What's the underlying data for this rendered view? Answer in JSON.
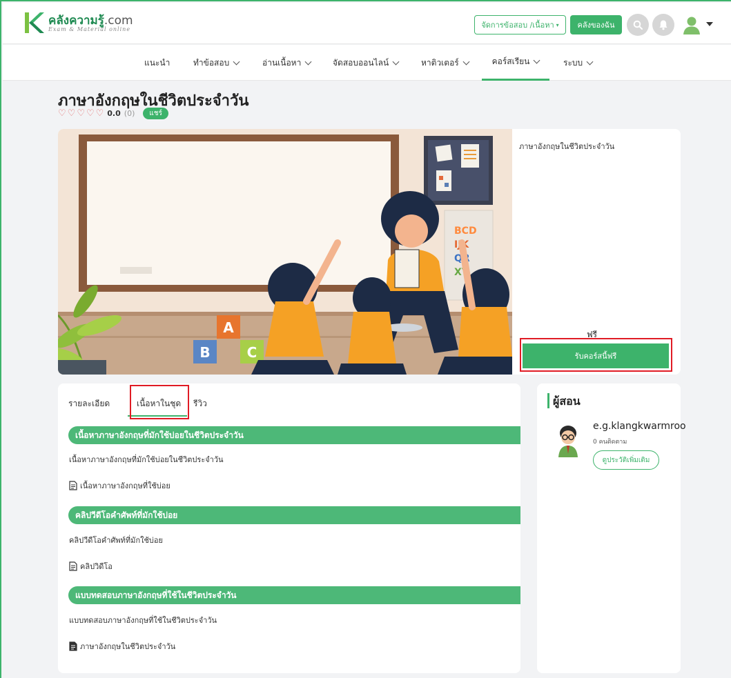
{
  "header": {
    "logo_text": "คลังความรู้",
    "logo_domain": ".com",
    "logo_tagline": "Exam & Material online",
    "manage_button": "จัดการข้อสอบ /เนื้อหา",
    "my_button": "คลังของฉัน"
  },
  "nav": {
    "items": [
      {
        "label": "แนะนำ"
      },
      {
        "label": "ทำข้อสอบ"
      },
      {
        "label": "อ่านเนื้อหา"
      },
      {
        "label": "จัดสอบออนไลน์"
      },
      {
        "label": "หาติวเตอร์"
      },
      {
        "label": "คอร์สเรียน"
      },
      {
        "label": "ระบบ"
      }
    ]
  },
  "course": {
    "title": "ภาษาอังกฤษในชีวิตประจำวัน",
    "rating_value": "0.0",
    "rating_count": "(0)",
    "rating_stars": 0,
    "share_label": "แชร์",
    "side_title": "ภาษาอังกฤษในชีวิตประจำวัน",
    "price_label": "ฟรี",
    "enroll_button": "รับคอร์สนี้ฟรี"
  },
  "hero_image": {
    "blocks": [
      "A",
      "B",
      "C"
    ],
    "board_letters": "BCD\nIJK\nQR\nXY"
  },
  "tabs": [
    {
      "label": "รายละเอียด"
    },
    {
      "label": "เนื้อหาในชุด"
    },
    {
      "label": "รีวิว"
    }
  ],
  "sections": [
    {
      "title": "เนื้อหาภาษาอังกฤษที่มักใช้บ่อยในชีวิตประจำวัน",
      "description": "เนื้อหาภาษาอังกฤษที่มักใช้บ่อยในชีวิตประจำวัน",
      "item": "เนื้อหาภาษาอังกฤษที่ใช้บ่อย"
    },
    {
      "title": "คลิปวีดีโอคำศัพท์ที่มักใช้บ่อย",
      "description": "คลิปวีดีโอคำศัพท์ที่มักใช้บ่อย",
      "item": "คลิปวิดีโอ"
    },
    {
      "title": "แบบทดสอบภาษาอังกฤษที่ใช้ในชีวิตประจำวัน",
      "description": "แบบทดสอบภาษาอังกฤษที่ใช้ในชีวิตประจำวัน",
      "item": "ภาษาอังกฤษในชีวิตประจำวัน"
    }
  ],
  "teacher": {
    "heading": "ผู้สอน",
    "name": "e.g.klangkwarmroo",
    "followers": "0 คนติดตาม",
    "more_button": "ดูประวัติเพิ่มเติม"
  },
  "colors": {
    "accent": "#3db36b",
    "section": "#4db878",
    "highlight_box": "#e01b24"
  }
}
